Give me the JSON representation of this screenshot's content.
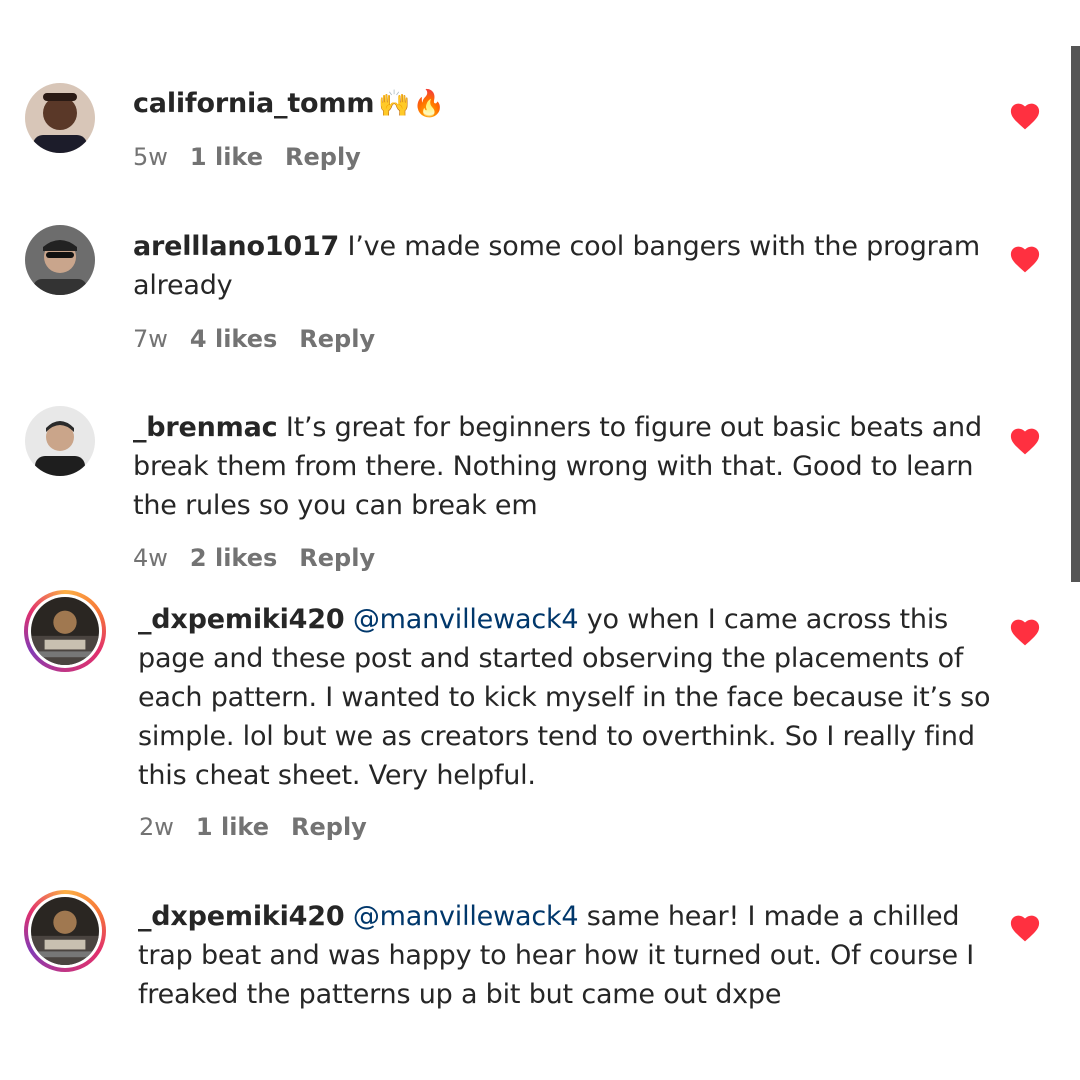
{
  "comments": [
    {
      "username": "california_tomm",
      "text": "",
      "emoji": "🙌🔥",
      "time": "5w",
      "likes": "1 like",
      "reply": "Reply"
    },
    {
      "username": "arelllano1017",
      "text": " I’ve made some cool bangers with the program already",
      "time": "7w",
      "likes": "4 likes",
      "reply": "Reply"
    },
    {
      "username": "_brenmac",
      "text": " It’s great for beginners to figure out basic beats and break them from there. Nothing wrong with that. Good to learn the rules so you can break em",
      "time": "4w",
      "likes": "2 likes",
      "reply": "Reply"
    },
    {
      "username": "_dxpemiki420",
      "mention": " @manvillewack4",
      "text": " yo when I came across this page and these post and started observing the placements of each pattern. I wanted to kick myself in the face because it’s so simple. lol but we as creators tend to overthink. So I really find this cheat sheet. Very helpful.",
      "time": "2w",
      "likes": "1 like",
      "reply": "Reply"
    },
    {
      "username": "_dxpemiki420",
      "mention": " @manvillewack4",
      "text": " same hear! I made a chilled trap beat and was happy to hear how it turned out. Of course I freaked the patterns up a bit but came out dxpe"
    }
  ],
  "icons": {
    "heart": "heart-icon",
    "heart_color": "#ff3040"
  },
  "colors": {
    "mention": "#00376b",
    "meta": "#737373",
    "text": "#262626"
  }
}
